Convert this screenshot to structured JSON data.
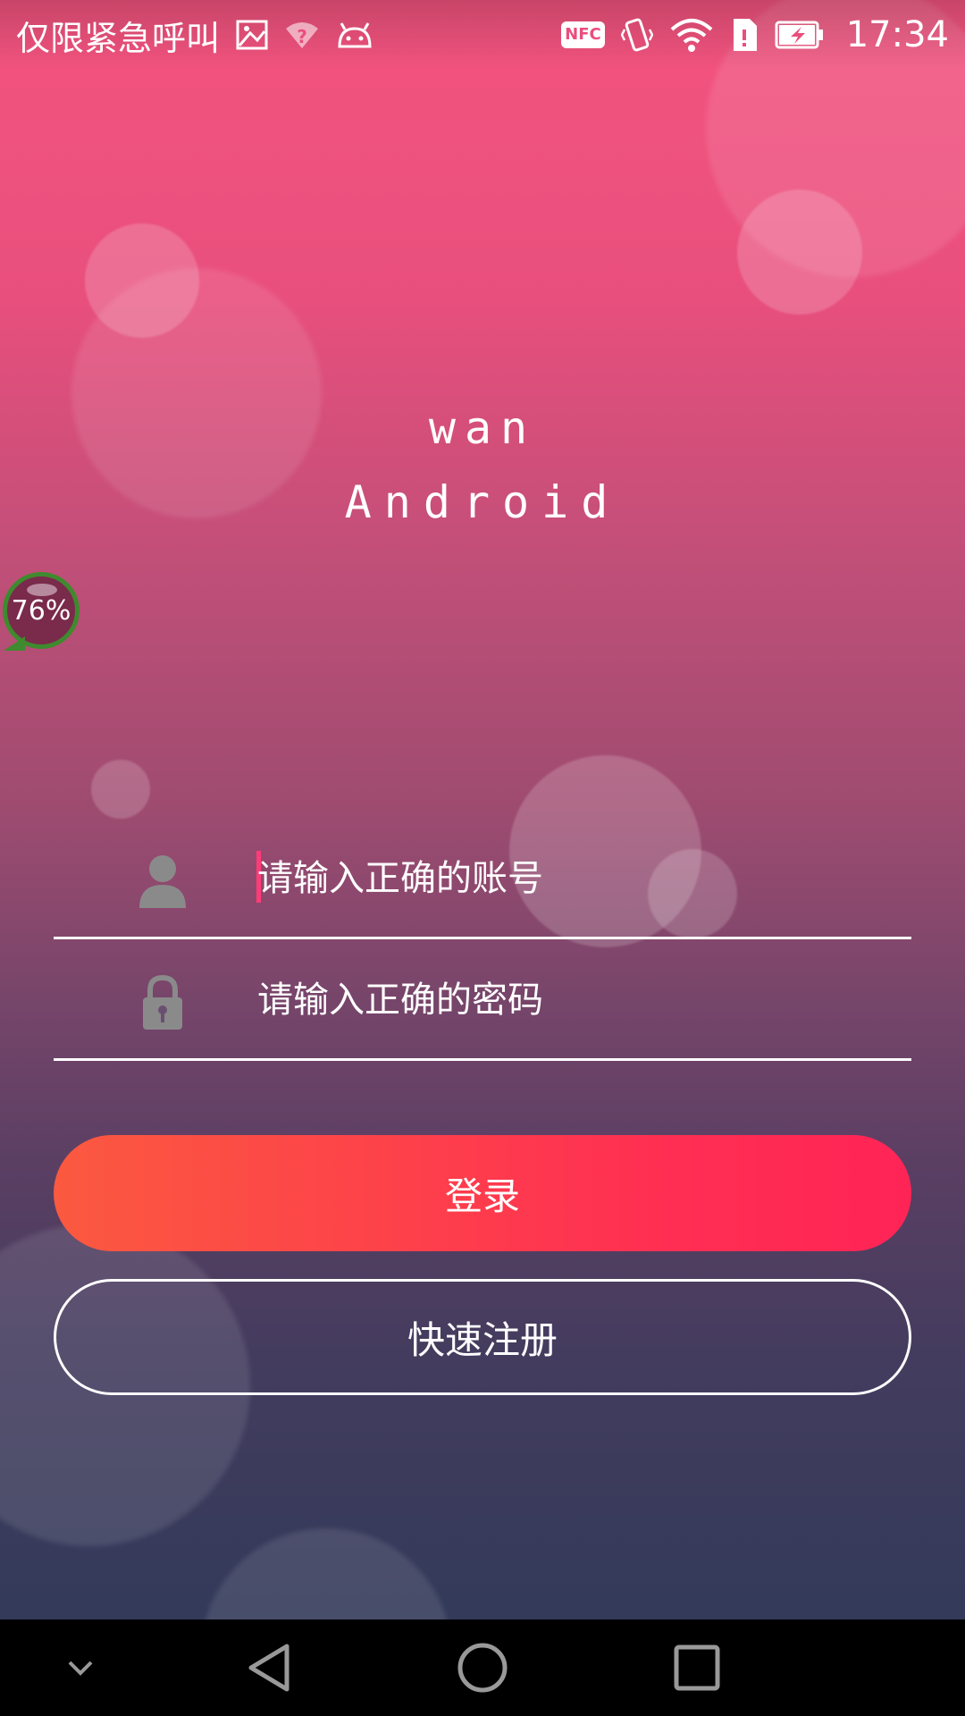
{
  "status_bar": {
    "carrier": "仅限紧急呼叫",
    "nfc_label": "NFC",
    "time": "17:34",
    "icons": [
      "image-icon",
      "wifi-question-icon",
      "android-icon",
      "nfc-icon",
      "vibrate-icon",
      "wifi-icon",
      "sim-icon",
      "battery-charging-icon"
    ]
  },
  "logo": {
    "line1": "wan",
    "line2": "Android"
  },
  "floating_widget": {
    "percent": "76%"
  },
  "form": {
    "account_placeholder": "请输入正确的账号",
    "password_placeholder": "请输入正确的密码",
    "account_value": "",
    "password_value": ""
  },
  "buttons": {
    "login": "登录",
    "register": "快速注册"
  },
  "colors": {
    "login_gradient_start": "#fb5940",
    "login_gradient_end": "#ff2456",
    "cursor": "#ff3c78",
    "widget_ring": "#3f8a2e"
  },
  "nav_bar": {
    "icons": [
      "chevron-down-icon",
      "back-icon",
      "home-icon",
      "recents-icon"
    ]
  }
}
